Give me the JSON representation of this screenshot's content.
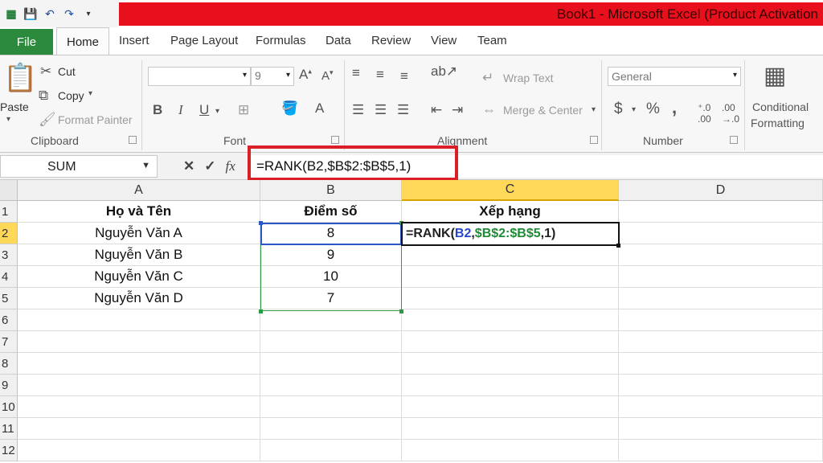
{
  "window": {
    "title": "Book1 - Microsoft Excel (Product Activation",
    "title_color": "#e8101c"
  },
  "quick_access": [
    "save-icon",
    "undo-icon",
    "redo-icon",
    "customize-icon"
  ],
  "tabs": {
    "file": "File",
    "home": "Home",
    "insert": "Insert",
    "page_layout": "Page Layout",
    "formulas": "Formulas",
    "data": "Data",
    "review": "Review",
    "view": "View",
    "team": "Team"
  },
  "ribbon": {
    "clipboard": {
      "label": "Clipboard",
      "paste": "Paste",
      "cut": "Cut",
      "copy": "Copy",
      "format_painter": "Format Painter"
    },
    "font": {
      "label": "Font",
      "font_size": "9",
      "bold": "B",
      "italic": "I",
      "underline": "U"
    },
    "alignment": {
      "label": "Alignment",
      "wrap_text": "Wrap Text",
      "merge_center": "Merge & Center"
    },
    "number": {
      "label": "Number",
      "format": "General",
      "currency": "$",
      "percent": "%",
      "comma": ","
    },
    "styles": {
      "conditional": "Conditional",
      "formatting": "Formatting"
    }
  },
  "formula_bar": {
    "name_box": "SUM",
    "formula": "=RANK(B2,$B$2:$B$5,1)",
    "fx": "fx"
  },
  "columns": [
    "A",
    "B",
    "C",
    "D"
  ],
  "rows": [
    "1",
    "2",
    "3",
    "4",
    "5",
    "6",
    "7",
    "8",
    "9",
    "10",
    "11",
    "12"
  ],
  "sheet": {
    "headers": {
      "a": "Họ và Tên",
      "b": "Điểm số",
      "c": "Xếp hạng"
    },
    "data": [
      {
        "name": "Nguyễn Văn A",
        "score": "8"
      },
      {
        "name": "Nguyễn Văn B",
        "score": "9"
      },
      {
        "name": "Nguyễn Văn C",
        "score": "10"
      },
      {
        "name": "Nguyễn Văn D",
        "score": "7"
      }
    ],
    "c2_formula": {
      "prefix": "=RANK(",
      "ref": "B2",
      "comma1": ",",
      "range": "$B$2:$B$5",
      "suffix": ",1)"
    }
  }
}
